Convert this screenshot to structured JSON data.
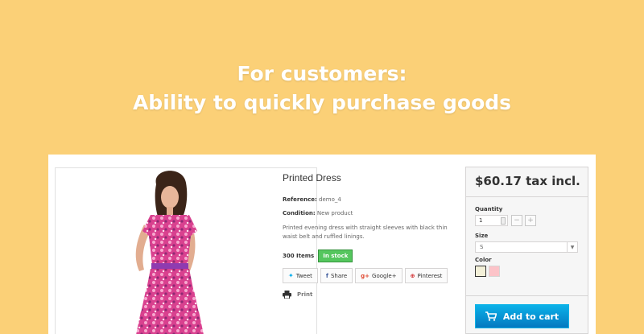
{
  "headline": {
    "line1": "For customers:",
    "line2": "Ability to quickly purchase goods"
  },
  "product": {
    "name": "Printed Dress",
    "reference_label": "Reference:",
    "reference_value": "demo_4",
    "condition_label": "Condition:",
    "condition_value": "New product",
    "description": "Printed evening dress with straight sleeves with black thin waist belt and ruffled linings.",
    "quantity_text": "300 Items",
    "stock_badge": "In stock",
    "share_buttons": [
      "Tweet",
      "Share",
      "Google+",
      "Pinterest"
    ],
    "print_label": "Print"
  },
  "buy_box": {
    "price": "$60.17 tax incl.",
    "quantity_label": "Quantity",
    "quantity_value": "1",
    "minus": "−",
    "plus": "+",
    "size_label": "Size",
    "size_value": "S",
    "color_label": "Color",
    "colors": [
      "#f3f0d8",
      "#fcc3c8"
    ],
    "add_to_cart": "Add to cart"
  },
  "colors": {
    "background": "#fbd077",
    "accent_blue": "#0b8dd4",
    "in_stock_green": "#55c65e"
  }
}
